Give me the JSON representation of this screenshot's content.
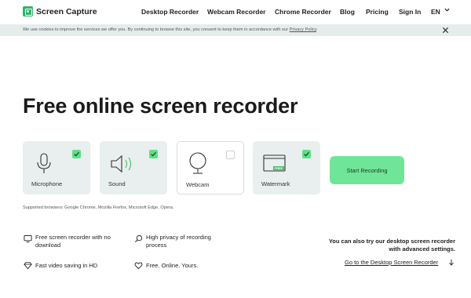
{
  "header": {
    "logo_text": "Screen Capture",
    "nav": [
      "Desktop Recorder",
      "Webcam Recorder",
      "Chrome Recorder",
      "Blog",
      "Pricing",
      "Sign In"
    ],
    "language": "EN"
  },
  "cookie": {
    "text": "We use cookies to improve the services we offer you. By continuing to browse this site, you consent to keep them in accordance with our",
    "link": "Privacy Policy",
    "period": "."
  },
  "hero": {
    "title": "Free online screen recorder"
  },
  "options": [
    {
      "label": "Microphone",
      "checked": true
    },
    {
      "label": "Sound",
      "checked": true
    },
    {
      "label": "Webcam",
      "checked": false
    },
    {
      "label": "Watermark",
      "checked": true,
      "badge": "FREE"
    }
  ],
  "start_button": "Start Recording",
  "browsers": "Supported browsers: Google Chrome, Mozilla Firefox, Microsoft Edge, Opera.",
  "features": [
    {
      "line1": "Free screen recorder with no",
      "line2": "download"
    },
    {
      "line1": "High privacy of recording",
      "line2": "process"
    },
    {
      "line1": "Fast video saving in HD",
      "line2": ""
    },
    {
      "line1": "Free. Online. Yours.",
      "line2": ""
    }
  ],
  "desktop": {
    "line1": "You can also try our desktop screen recorder",
    "line2": "with advanced settings.",
    "link": "Go to the Desktop Screen Recorder"
  },
  "colors": {
    "accent": "#6fe597",
    "brand": "#2fb36a",
    "card_bg": "#e9eeee",
    "cookie_bg": "#e6ecec"
  }
}
